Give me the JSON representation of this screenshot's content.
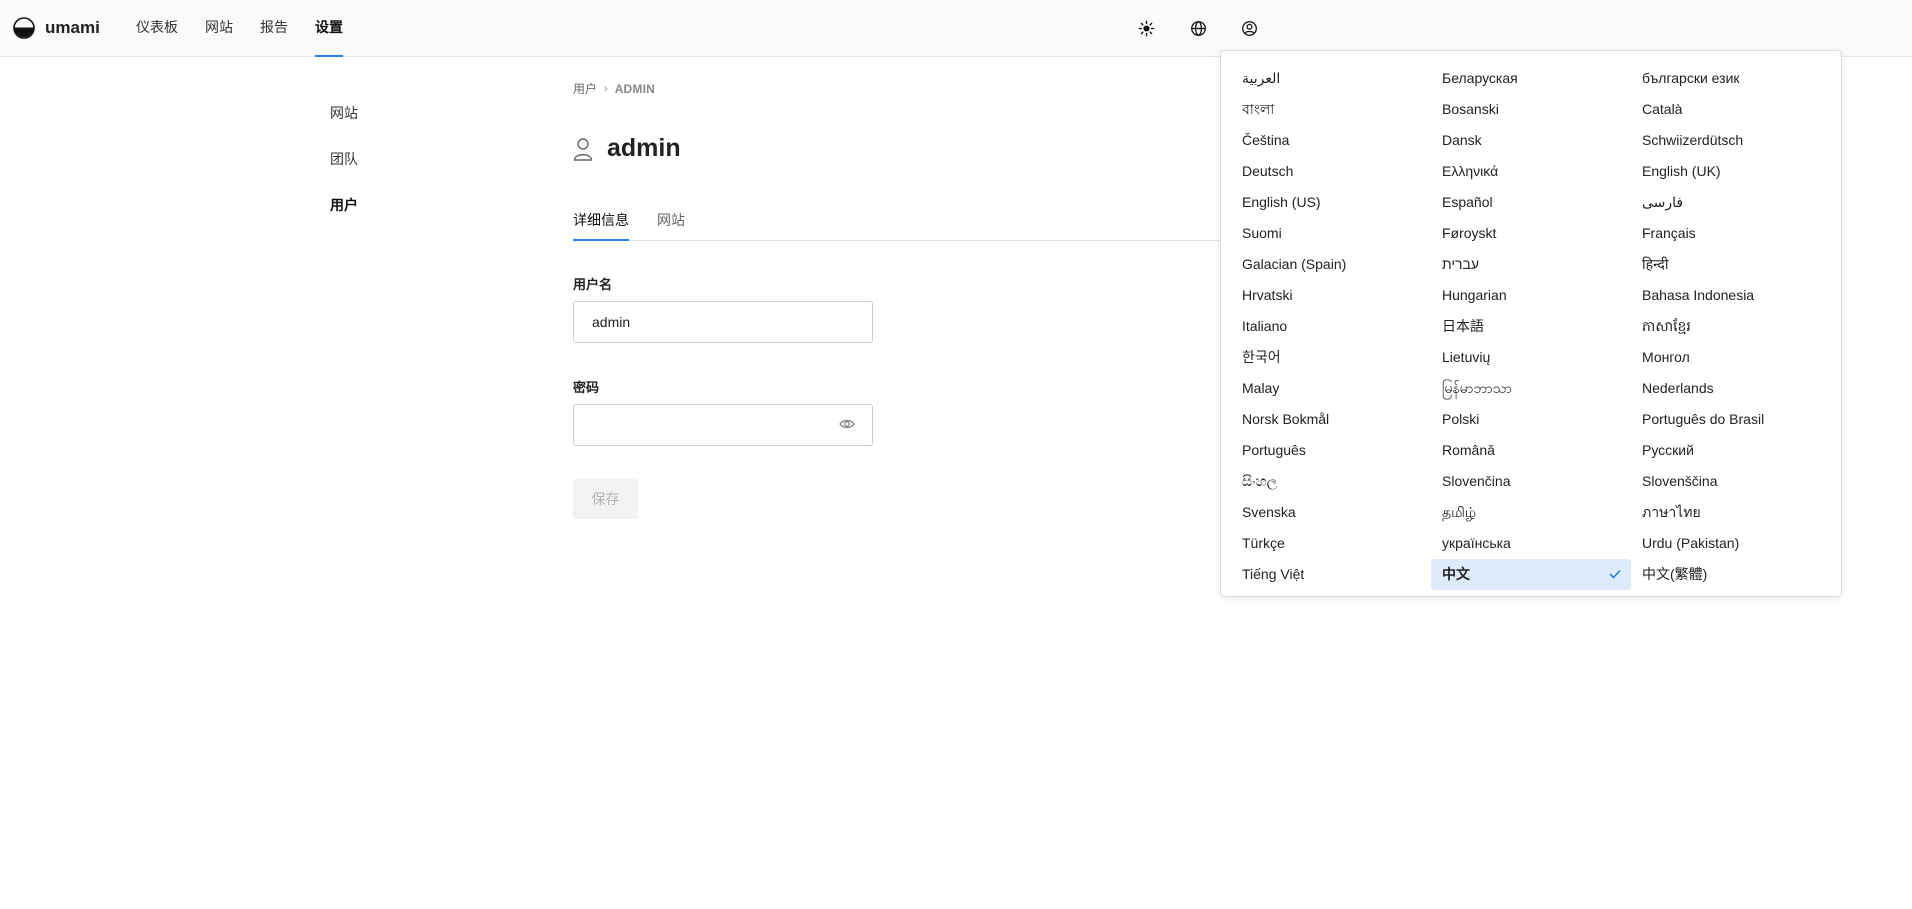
{
  "app": {
    "name": "umami"
  },
  "nav": {
    "items": [
      "仪表板",
      "网站",
      "报告",
      "设置"
    ],
    "active_index": 3
  },
  "top_icons": [
    "sun-icon",
    "globe-icon",
    "user-circle-icon"
  ],
  "side_nav": {
    "items": [
      "网站",
      "团队",
      "用户"
    ],
    "active_index": 2
  },
  "breadcrumb": {
    "parent": "用户",
    "current": "ADMIN"
  },
  "page": {
    "title": "admin"
  },
  "tabs": {
    "items": [
      "详细信息",
      "网站"
    ],
    "active_index": 0
  },
  "form": {
    "username_label": "用户名",
    "username_value": "admin",
    "password_label": "密码",
    "password_value": "",
    "save_label": "保存"
  },
  "languages": {
    "selected": "中文",
    "items": [
      "العربية",
      "Беларуская",
      "български език",
      "বাংলা",
      "Bosanski",
      "Català",
      "Čeština",
      "Dansk",
      "Schwiizerdütsch",
      "Deutsch",
      "Ελληνικά",
      "English (UK)",
      "English (US)",
      "Español",
      "فارسی",
      "Suomi",
      "Føroyskt",
      "Français",
      "Galacian (Spain)",
      "עברית",
      "हिन्दी",
      "Hrvatski",
      "Hungarian",
      "Bahasa Indonesia",
      "Italiano",
      "日本語",
      "ភាសាខ្មែរ",
      "한국어",
      "Lietuvių",
      "Монгол",
      "Malay",
      "မြန်မာဘာသာ",
      "Nederlands",
      "Norsk Bokmål",
      "Polski",
      "Português do Brasil",
      "Português",
      "Română",
      "Русский",
      "සිංහල",
      "Slovenčina",
      "Slovenščina",
      "Svenska",
      "தமிழ்",
      "ภาษาไทย",
      "Türkçe",
      "українська",
      "Urdu (Pakistan)",
      "Tiếng Việt",
      "中文",
      "中文(繁體)"
    ]
  },
  "colors": {
    "accent": "#2680eb",
    "selected_bg": "#deebfa"
  }
}
